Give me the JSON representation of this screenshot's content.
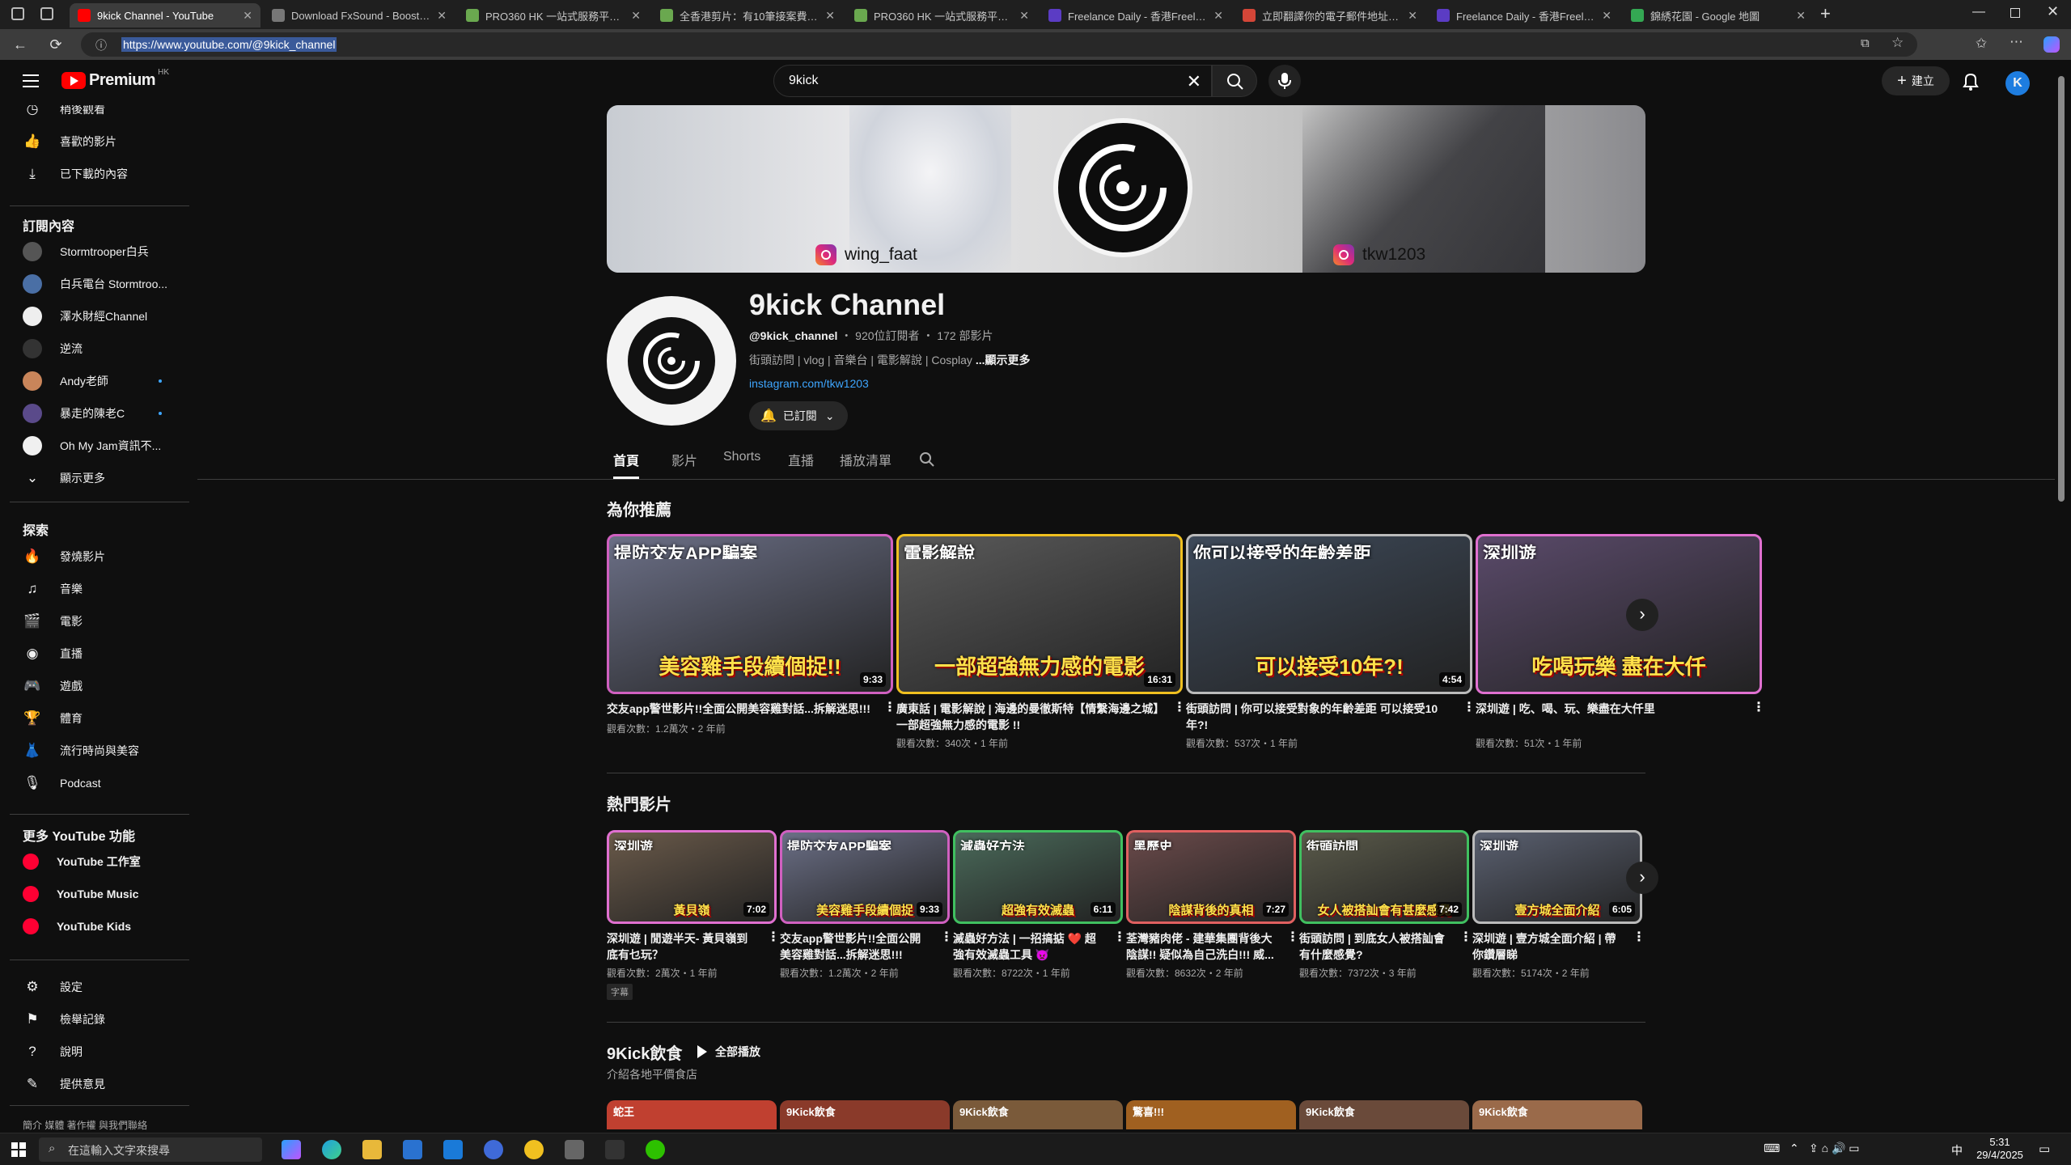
{
  "browser": {
    "tabs": [
      {
        "title": "9kick Channel - YouTube",
        "fav_color": "#ff0000",
        "active": true
      },
      {
        "title": "Download FxSound - Boost Your",
        "fav_color": "#777777"
      },
      {
        "title": "PRO360 HK 一站式服務平台 - 找到",
        "fav_color": "#6aa84f"
      },
      {
        "title": "全香港剪片：有10筆接案費購工作",
        "fav_color": "#6aa84f"
      },
      {
        "title": "PRO360 HK 一站式服務平台 - 找到",
        "fav_color": "#6aa84f"
      },
      {
        "title": "Freelance Daily - 香港Freelance自",
        "fav_color": "#5b3cc4"
      },
      {
        "title": "立即翻譯你的電子郵件地址 - tsoi",
        "fav_color": "#d44638"
      },
      {
        "title": "Freelance Daily - 香港Freelance自",
        "fav_color": "#5b3cc4"
      },
      {
        "title": "錦綉花園 - Google 地圖",
        "fav_color": "#34a853"
      }
    ],
    "url": "https://www.youtube.com/@9kick_channel"
  },
  "header": {
    "logo_text": "Premium",
    "region": "HK",
    "search_value": "9kick",
    "create_label": "建立",
    "avatar_letter": "K"
  },
  "sidebar": {
    "top_items": [
      {
        "label": "稍後觀看",
        "icon": "clock-icon"
      },
      {
        "label": "喜歡的影片",
        "icon": "thumbs-up-icon"
      },
      {
        "label": "已下載的內容",
        "icon": "download-icon"
      }
    ],
    "subs_title": "訂閱內容",
    "subs": [
      {
        "label": "Stormtrooper白兵",
        "color": "#555555",
        "dot": false
      },
      {
        "label": "白兵電台 Stormtroo...",
        "color": "#4a6fa5",
        "dot": false
      },
      {
        "label": "澤水財經Channel",
        "color": "#eeeeee",
        "dot": false
      },
      {
        "label": "逆流",
        "color": "#333333",
        "dot": false
      },
      {
        "label": "Andy老師",
        "color": "#c9855a",
        "dot": true
      },
      {
        "label": "暴走的陳老C",
        "color": "#5a4a8a",
        "dot": true
      },
      {
        "label": "Oh My Jam資訊不...",
        "color": "#f0f0f0",
        "dot": false
      }
    ],
    "show_more": "顯示更多",
    "explore_title": "探索",
    "explore": [
      {
        "label": "發燒影片",
        "icon": "trending-icon"
      },
      {
        "label": "音樂",
        "icon": "music-icon"
      },
      {
        "label": "電影",
        "icon": "movie-icon"
      },
      {
        "label": "直播",
        "icon": "live-icon"
      },
      {
        "label": "遊戲",
        "icon": "gaming-icon"
      },
      {
        "label": "體育",
        "icon": "trophy-icon"
      },
      {
        "label": "流行時尚與美容",
        "icon": "fashion-icon"
      },
      {
        "label": "Podcast",
        "icon": "podcast-icon"
      }
    ],
    "more_title": "更多 YouTube 功能",
    "more": [
      {
        "label": "YouTube 工作室"
      },
      {
        "label": "YouTube Music"
      },
      {
        "label": "YouTube Kids"
      }
    ],
    "settings": [
      {
        "label": "設定",
        "icon": "gear-icon"
      },
      {
        "label": "檢舉記錄",
        "icon": "flag-icon"
      },
      {
        "label": "說明",
        "icon": "help-icon"
      },
      {
        "label": "提供意見",
        "icon": "feedback-icon"
      }
    ],
    "footer": "簡介  媒體  著作權  與我們聯絡"
  },
  "banner": {
    "ig_left": "wing_faat",
    "ig_right": "tkw1203"
  },
  "channel": {
    "name": "9kick Channel",
    "handle": "@9kick_channel",
    "subs": "920位訂閱者",
    "videos": "172 部影片",
    "description": "街頭訪問 | vlog | 音樂台 | 電影解說 | Cosplay",
    "more": "...顯示更多",
    "link": "instagram.com/tkw1203",
    "subscribed_label": "已訂閱"
  },
  "tabs": [
    "首頁",
    "影片",
    "Shorts",
    "直播",
    "播放清單"
  ],
  "sections": {
    "recommended_title": "為你推薦",
    "popular_title": "熱門影片",
    "playlist_title": "9Kick飲食",
    "play_all": "全部播放",
    "playlist_sub": "介紹各地平價食店"
  },
  "recommended": [
    {
      "thumb_top": "提防交友APP騙案",
      "thumb_cap": "美容雞手段續個捉!!",
      "duration": "9:33",
      "title": "交友app警世影片!!全面公開美容雞對話...拆解迷思!!!",
      "meta": "觀看次數：1.2萬次・2 年前",
      "bg": "#6b6f86",
      "border": "#d060c0"
    },
    {
      "thumb_top": "電影解說",
      "thumb_cap": "一部超強無力感的電影",
      "duration": "16:31",
      "title": "廣東話 | 電影解說 | 海邊的曼徹斯特【情繫海邊之城】一部超強無力感的電影 !!",
      "meta": "觀看次數：340次・1 年前",
      "bg": "#5a5a5a",
      "border": "#f0c020"
    },
    {
      "thumb_top": "你可以接受的年齡差距",
      "thumb_cap": "可以接受10年?!",
      "duration": "4:54",
      "title": "街頭訪問 | 你可以接受對象的年齡差距 可以接受10年?!",
      "meta": "觀看次數：537次・1 年前",
      "bg": "#3e4a5a",
      "border": "#bbbbbb"
    },
    {
      "thumb_top": "深圳遊",
      "thumb_cap": "吃喝玩樂 盡在大仟",
      "duration": "",
      "title": "深圳遊 | 吃、喝、玩、樂盡在大仟里",
      "meta": "觀看次數：51次・1 年前",
      "bg": "#5a4a6a",
      "border": "#e070d0"
    }
  ],
  "popular": [
    {
      "thumb_top": "深圳遊",
      "thumb_cap": "黃貝嶺",
      "duration": "7:02",
      "title": "深圳遊 | 閒遊半天- 黃貝嶺到底有乜玩？",
      "meta": "觀看次數：2萬次・1 年前",
      "bg": "#6a5a4a",
      "border": "#e070d0",
      "badge": "字幕"
    },
    {
      "thumb_top": "提防交友APP騙案",
      "thumb_cap": "美容雞手段續個捉",
      "duration": "9:33",
      "title": "交友app警世影片!!全面公開美容雞對話...拆解迷思!!!",
      "meta": "觀看次數：1.2萬次・2 年前",
      "bg": "#6b6f86",
      "border": "#d060c0",
      "badge": ""
    },
    {
      "thumb_top": "減蟲好方法",
      "thumb_cap": "超強有效滅蟲",
      "duration": "6:11",
      "title": "滅蟲好方法 | 一招搞掂 ❤️ 超強有效滅蟲工具 👿",
      "meta": "觀看次數：8722次・1 年前",
      "bg": "#4a6a5a",
      "border": "#40c060",
      "badge": ""
    },
    {
      "thumb_top": "黑歷史",
      "thumb_cap": "陰謀背後的真相",
      "duration": "7:27",
      "title": "荃灣豬肉佬 - 建華集團背後大陰謀!! 疑似為自己洗白!!! 威...",
      "meta": "觀看次數：8632次・2 年前",
      "bg": "#6a4a4a",
      "border": "#e06060",
      "badge": ""
    },
    {
      "thumb_top": "街頭訪問",
      "thumb_cap": "女人被搭訕會有甚麼感覺",
      "duration": "7:42",
      "title": "街頭訪問 | 到底女人被搭訕會有什麼感覺?",
      "meta": "觀看次數：7372次・3 年前",
      "bg": "#5a5a4a",
      "border": "#40c060",
      "badge": ""
    },
    {
      "thumb_top": "深圳遊",
      "thumb_cap": "壹方城全面介紹",
      "duration": "6:05",
      "title": "深圳遊 | 壹方城全面介紹 | 帶你鑽層睇",
      "meta": "觀看次數：5174次・2 年前",
      "bg": "#5a6070",
      "border": "#bbbbbb",
      "badge": ""
    }
  ],
  "playlist_thumbs": [
    {
      "text": "蛇王",
      "bg": "#c04030"
    },
    {
      "text": "9Kick飲食",
      "bg": "#8a3a2a"
    },
    {
      "text": "9Kick飲食",
      "bg": "#7a5a3a"
    },
    {
      "text": "驚喜!!!",
      "bg": "#a06020"
    },
    {
      "text": "9Kick飲食",
      "bg": "#6a4a3a"
    },
    {
      "text": "9Kick飲食",
      "bg": "#9a6a4a"
    }
  ],
  "taskbar": {
    "search_placeholder": "在這輸入文字來搜尋",
    "time": "5:31",
    "date": "29/4/2025",
    "ime": "中"
  }
}
